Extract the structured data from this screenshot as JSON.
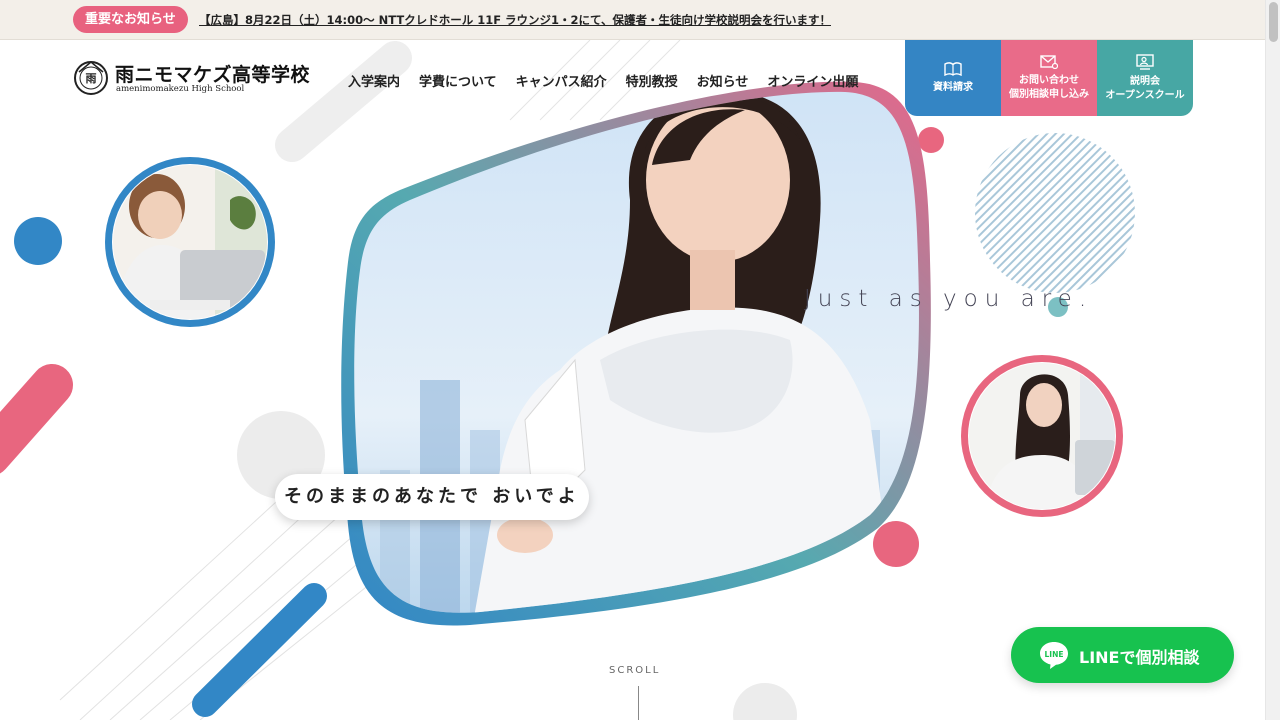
{
  "notice": {
    "badge": "重要なお知らせ",
    "text": "【広島】8月22日（土）14:00〜 NTTクレドホール 11F ラウンジ1・2にて、保護者・生徒向け学校説明会を行います！"
  },
  "logo": {
    "emblem_char": "雨",
    "name": "雨ニモマケズ高等学校",
    "sub": "amenimomakezu High School"
  },
  "nav": [
    "入学案内",
    "学費について",
    "キャンパス紹介",
    "特別教授",
    "お知らせ",
    "オンライン出願"
  ],
  "cta": {
    "brochure": "資料請求",
    "contact_line1": "お問い合わせ",
    "contact_line2": "個別相談申し込み",
    "info_line1": "説明会",
    "info_line2": "オープンスクール"
  },
  "hero": {
    "tagline": "そのままのあなたで おいでよ",
    "english": "Just as you are."
  },
  "scroll_label": "SCROLL",
  "line_button": {
    "icon_text": "LINE",
    "label": "LINEで個別相談"
  },
  "colors": {
    "pink": "#e8617f",
    "blue": "#3485c4",
    "teal": "#47a7a4",
    "line_green": "#17c24f",
    "notice_bg": "#f3efe9"
  },
  "icons": [
    "book-icon",
    "mail-icon",
    "presentation-icon",
    "line-chat-icon"
  ]
}
